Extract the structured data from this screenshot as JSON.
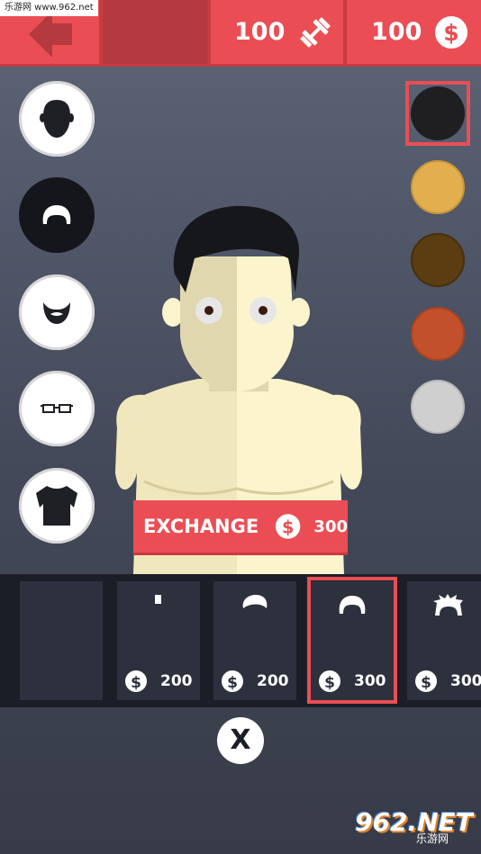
{
  "watermark_top": "乐游网 www.962.net",
  "watermark_bottom": {
    "brand": "962.NET",
    "sub": "乐游网"
  },
  "topbar": {
    "strength_value": "100",
    "strength_icon": "dumbbell-icon",
    "coins_value": "100",
    "coins_icon": "dollar-coin-icon"
  },
  "categories": [
    {
      "name": "head",
      "icon": "head-icon"
    },
    {
      "name": "hair",
      "icon": "hair-icon",
      "active": true
    },
    {
      "name": "beard",
      "icon": "beard-icon"
    },
    {
      "name": "glasses",
      "icon": "glasses-icon"
    },
    {
      "name": "shirt",
      "icon": "shirt-icon"
    }
  ],
  "colors": [
    "#1f1f21",
    "#e2ae4e",
    "#5c3d12",
    "#c2502a",
    "#cfcfcf"
  ],
  "selected_color_index": 0,
  "exchange": {
    "label": "EXCHANGE",
    "price": "300"
  },
  "items": [
    {
      "price": ""
    },
    {
      "price": "200"
    },
    {
      "price": "200"
    },
    {
      "price": "300"
    },
    {
      "price": "300"
    }
  ],
  "selected_item_index": 3,
  "close_label": "X"
}
